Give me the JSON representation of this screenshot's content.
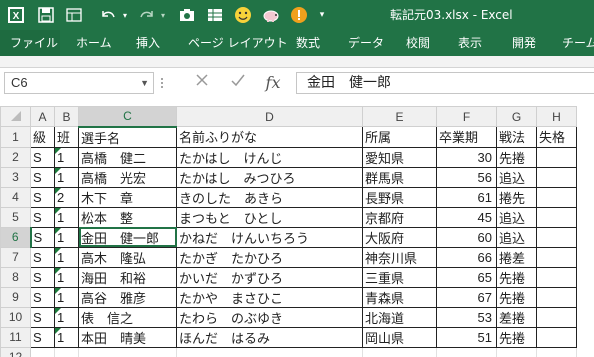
{
  "window": {
    "title": "転記元03.xlsx - Excel"
  },
  "quick_access": [
    "save-icon",
    "undo-icon",
    "redo-icon",
    "camera-icon",
    "table-icon",
    "table-icon",
    "smiley-icon",
    "piggy-bank-icon",
    "warning-icon",
    "customize-icon"
  ],
  "tabs": [
    "ファイル",
    "ホーム",
    "挿入",
    "ページ レイアウト",
    "数式",
    "データ",
    "校閲",
    "表示",
    "開発",
    "チーム"
  ],
  "namebox": {
    "value": "C6"
  },
  "formula": {
    "value": "金田　健一郎",
    "fx_label": "fx"
  },
  "columns": [
    "A",
    "B",
    "C",
    "D",
    "E",
    "F",
    "G",
    "H"
  ],
  "active_cell": {
    "col": "C",
    "row": 6
  },
  "rows": [
    {
      "n": "1",
      "cells": [
        "級",
        "班",
        "選手名",
        "名前ふりがな",
        "所属",
        "卒業期",
        "戦法",
        "失格"
      ]
    },
    {
      "n": "2",
      "cells": [
        "S",
        "1",
        "高橋　健二",
        "たかはし　けんじ",
        "愛知県",
        "30",
        "先捲",
        ""
      ]
    },
    {
      "n": "3",
      "cells": [
        "S",
        "1",
        "高橋　光宏",
        "たかはし　みつひろ",
        "群馬県",
        "56",
        "追込",
        ""
      ]
    },
    {
      "n": "4",
      "cells": [
        "S",
        "2",
        "木下　章",
        "きのした　あきら",
        "長野県",
        "61",
        "捲先",
        ""
      ]
    },
    {
      "n": "5",
      "cells": [
        "S",
        "1",
        "松本　整",
        "まつもと　ひとし",
        "京都府",
        "45",
        "追込",
        ""
      ]
    },
    {
      "n": "6",
      "cells": [
        "S",
        "1",
        "金田　健一郎",
        "かねだ　けんいちろう",
        "大阪府",
        "60",
        "追込",
        ""
      ]
    },
    {
      "n": "7",
      "cells": [
        "S",
        "1",
        "高木　隆弘",
        "たかぎ　たかひろ",
        "神奈川県",
        "66",
        "捲差",
        ""
      ]
    },
    {
      "n": "8",
      "cells": [
        "S",
        "1",
        "海田　和裕",
        "かいだ　かずひろ",
        "三重県",
        "65",
        "先捲",
        ""
      ]
    },
    {
      "n": "9",
      "cells": [
        "S",
        "1",
        "高谷　雅彦",
        "たかや　まさひこ",
        "青森県",
        "67",
        "先捲",
        ""
      ]
    },
    {
      "n": "10",
      "cells": [
        "S",
        "1",
        "俵　信之",
        "たわら　のぶゆき",
        "北海道",
        "53",
        "差捲",
        ""
      ]
    },
    {
      "n": "11",
      "cells": [
        "S",
        "1",
        "本田　晴美",
        "ほんだ　はるみ",
        "岡山県",
        "51",
        "先捲",
        ""
      ]
    },
    {
      "n": "12",
      "cells": [
        "",
        "",
        "",
        "",
        "",
        "",
        "",
        ""
      ]
    }
  ]
}
